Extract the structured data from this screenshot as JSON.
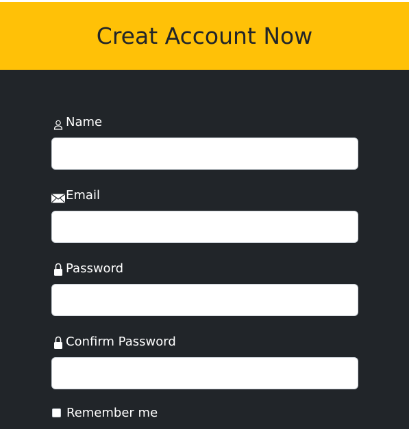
{
  "header": {
    "title": "Creat Account Now",
    "background_color": "#ffc107"
  },
  "form": {
    "background_color": "#212529",
    "fields": [
      {
        "label": "Name",
        "icon": "person-icon",
        "value": ""
      },
      {
        "label": "Email",
        "icon": "envelope-icon",
        "value": ""
      },
      {
        "label": "Password",
        "icon": "lock-icon",
        "value": ""
      },
      {
        "label": "Confirm Password",
        "icon": "lock-icon",
        "value": ""
      }
    ],
    "remember": {
      "label": "Remember me",
      "checked": false
    }
  }
}
